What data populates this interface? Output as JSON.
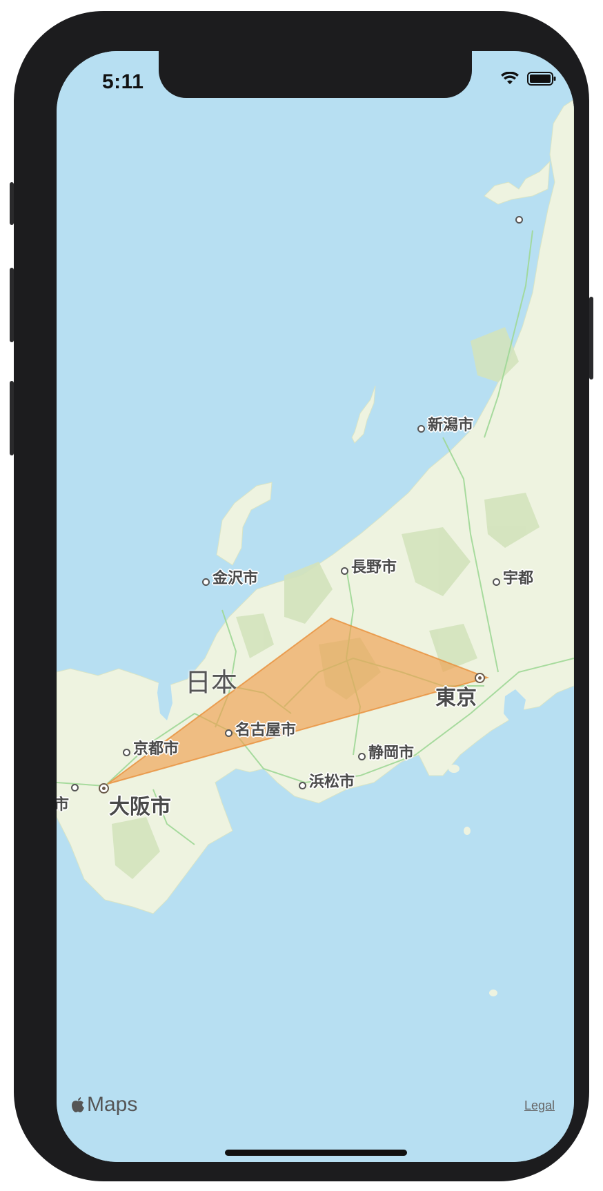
{
  "status_bar": {
    "time": "5:11"
  },
  "map": {
    "country_label": "日本",
    "cities": [
      {
        "id": "tokyo",
        "name": "東京"
      },
      {
        "id": "osaka",
        "name": "大阪市"
      },
      {
        "id": "nagoya",
        "name": "名古屋市"
      },
      {
        "id": "kyoto",
        "name": "京都市"
      },
      {
        "id": "kanazawa",
        "name": "金沢市"
      },
      {
        "id": "nagano",
        "name": "長野市"
      },
      {
        "id": "niigata",
        "name": "新潟市"
      },
      {
        "id": "shizuoka",
        "name": "静岡市"
      },
      {
        "id": "hamamatsu",
        "name": "浜松市"
      },
      {
        "id": "utsunomiya_partial",
        "name": "宇都"
      },
      {
        "id": "kobe_partial",
        "name": "市"
      }
    ],
    "polygon_color": "#f0a050",
    "water_color": "#b7dff2",
    "land_color": "#eef3e0"
  },
  "footer": {
    "brand": "Maps",
    "legal_link": "Legal"
  }
}
